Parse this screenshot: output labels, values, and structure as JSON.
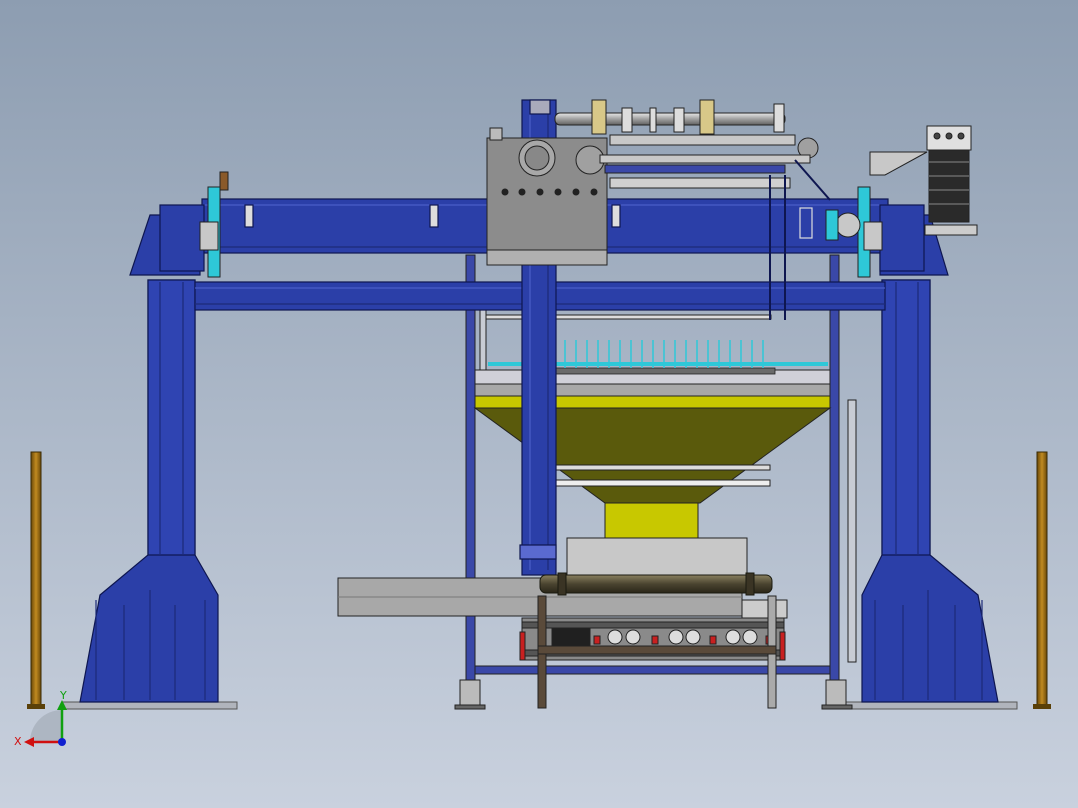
{
  "view": {
    "background_top": "#8d9db1",
    "background_bottom": "#c9d1de"
  },
  "colors": {
    "frame_blue": "#2b3fa8",
    "frame_blue_dark": "#1c2a78",
    "frame_blue_light": "#4a5ec8",
    "hopper_olive": "#5a5a0c",
    "hopper_yellow": "#c8c800",
    "steel_gray": "#8c8c8c",
    "steel_light": "#c8c8c8",
    "post_bronze": "#9a6a10",
    "cyan_accent": "#2ec8d8",
    "red_accent": "#c82020"
  },
  "axis_triad": {
    "x_label": "X",
    "y_label": "Y",
    "x_color": "#d01010",
    "y_color": "#10a010",
    "z_color": "#1020d0"
  },
  "icons": [
    "axis-triad-icon"
  ]
}
